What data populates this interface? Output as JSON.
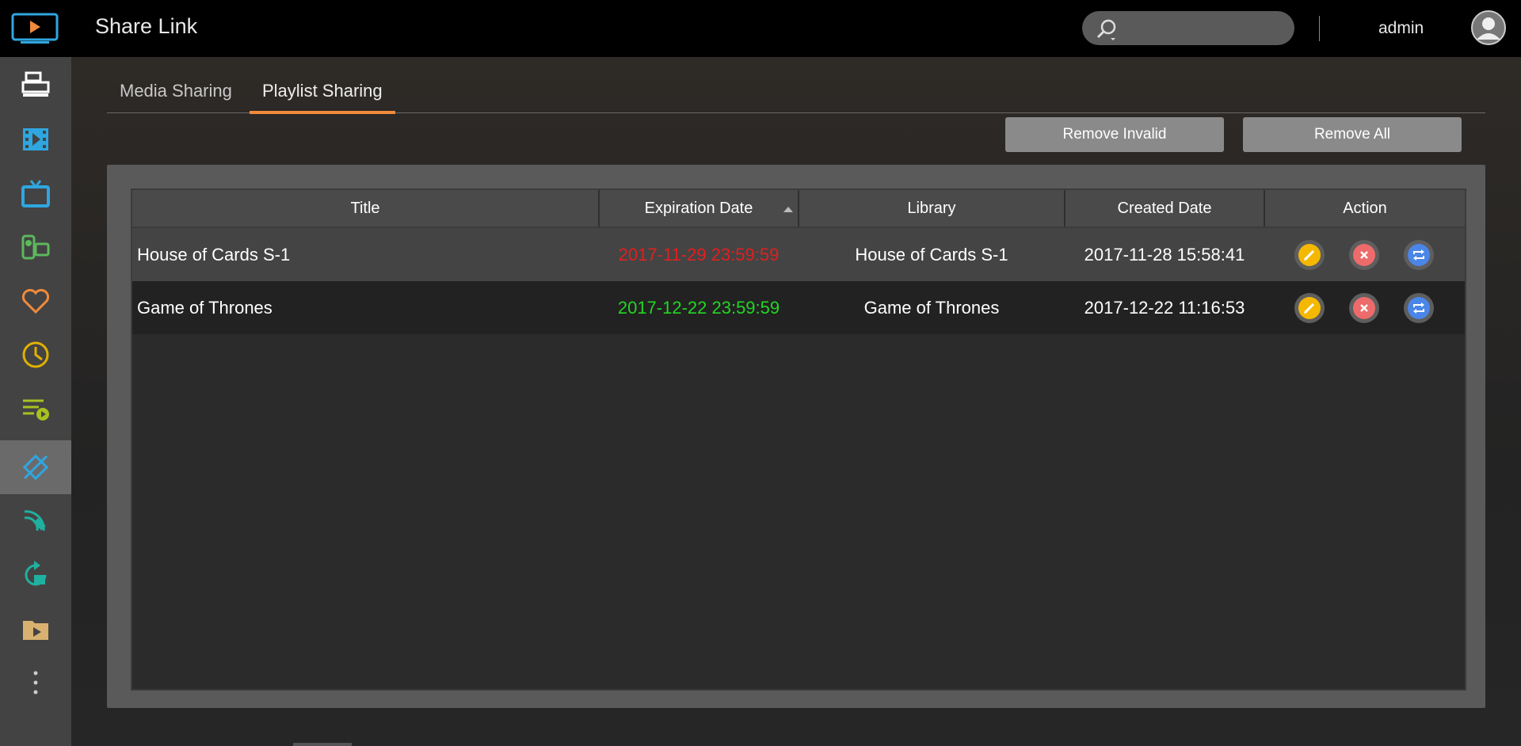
{
  "header": {
    "app_title": "Share Link",
    "search_placeholder": "",
    "username": "admin"
  },
  "sidebar": {
    "items": [
      {
        "icon": "server-icon",
        "color": "#ffffff"
      },
      {
        "icon": "film-icon",
        "color": "#2fa6e0"
      },
      {
        "icon": "tv-icon",
        "color": "#2fa6e0"
      },
      {
        "icon": "camera-photo-icon",
        "color": "#5cb85c"
      },
      {
        "icon": "heart-icon",
        "color": "#f08a3c"
      },
      {
        "icon": "clock-icon",
        "color": "#e0b000"
      },
      {
        "icon": "playlist-icon",
        "color": "#a8c020"
      },
      {
        "icon": "share-link-icon",
        "color": "#2fa6e0",
        "active": true
      },
      {
        "icon": "satellite-icon",
        "color": "#20b0a0"
      },
      {
        "icon": "media-refresh-icon",
        "color": "#20b0a0"
      },
      {
        "icon": "folder-media-icon",
        "color": "#d8b070"
      },
      {
        "icon": "more-icon",
        "color": "#cccccc"
      }
    ]
  },
  "tabs": [
    {
      "label": "Media Sharing",
      "active": false
    },
    {
      "label": "Playlist Sharing",
      "active": true
    }
  ],
  "toolbar": {
    "remove_invalid_label": "Remove Invalid",
    "remove_all_label": "Remove All"
  },
  "table": {
    "columns": [
      "Title",
      "Expiration Date",
      "Library",
      "Created Date",
      "Action"
    ],
    "rows": [
      {
        "title": "House of Cards S-1",
        "expiration": "2017-11-29 23:59:59",
        "expired": true,
        "library": "House of Cards S-1",
        "created": "2017-11-28 15:58:41"
      },
      {
        "title": "Game of Thrones",
        "expiration": "2017-12-22 23:59:59",
        "expired": false,
        "library": "Game of Thrones",
        "created": "2017-12-22 11:16:53"
      }
    ]
  },
  "colors": {
    "accent": "#f08a3c",
    "expired": "#e02020",
    "valid": "#22d622",
    "edit": "#f5b800",
    "delete": "#ee6b6b",
    "renew": "#4a86e8"
  }
}
